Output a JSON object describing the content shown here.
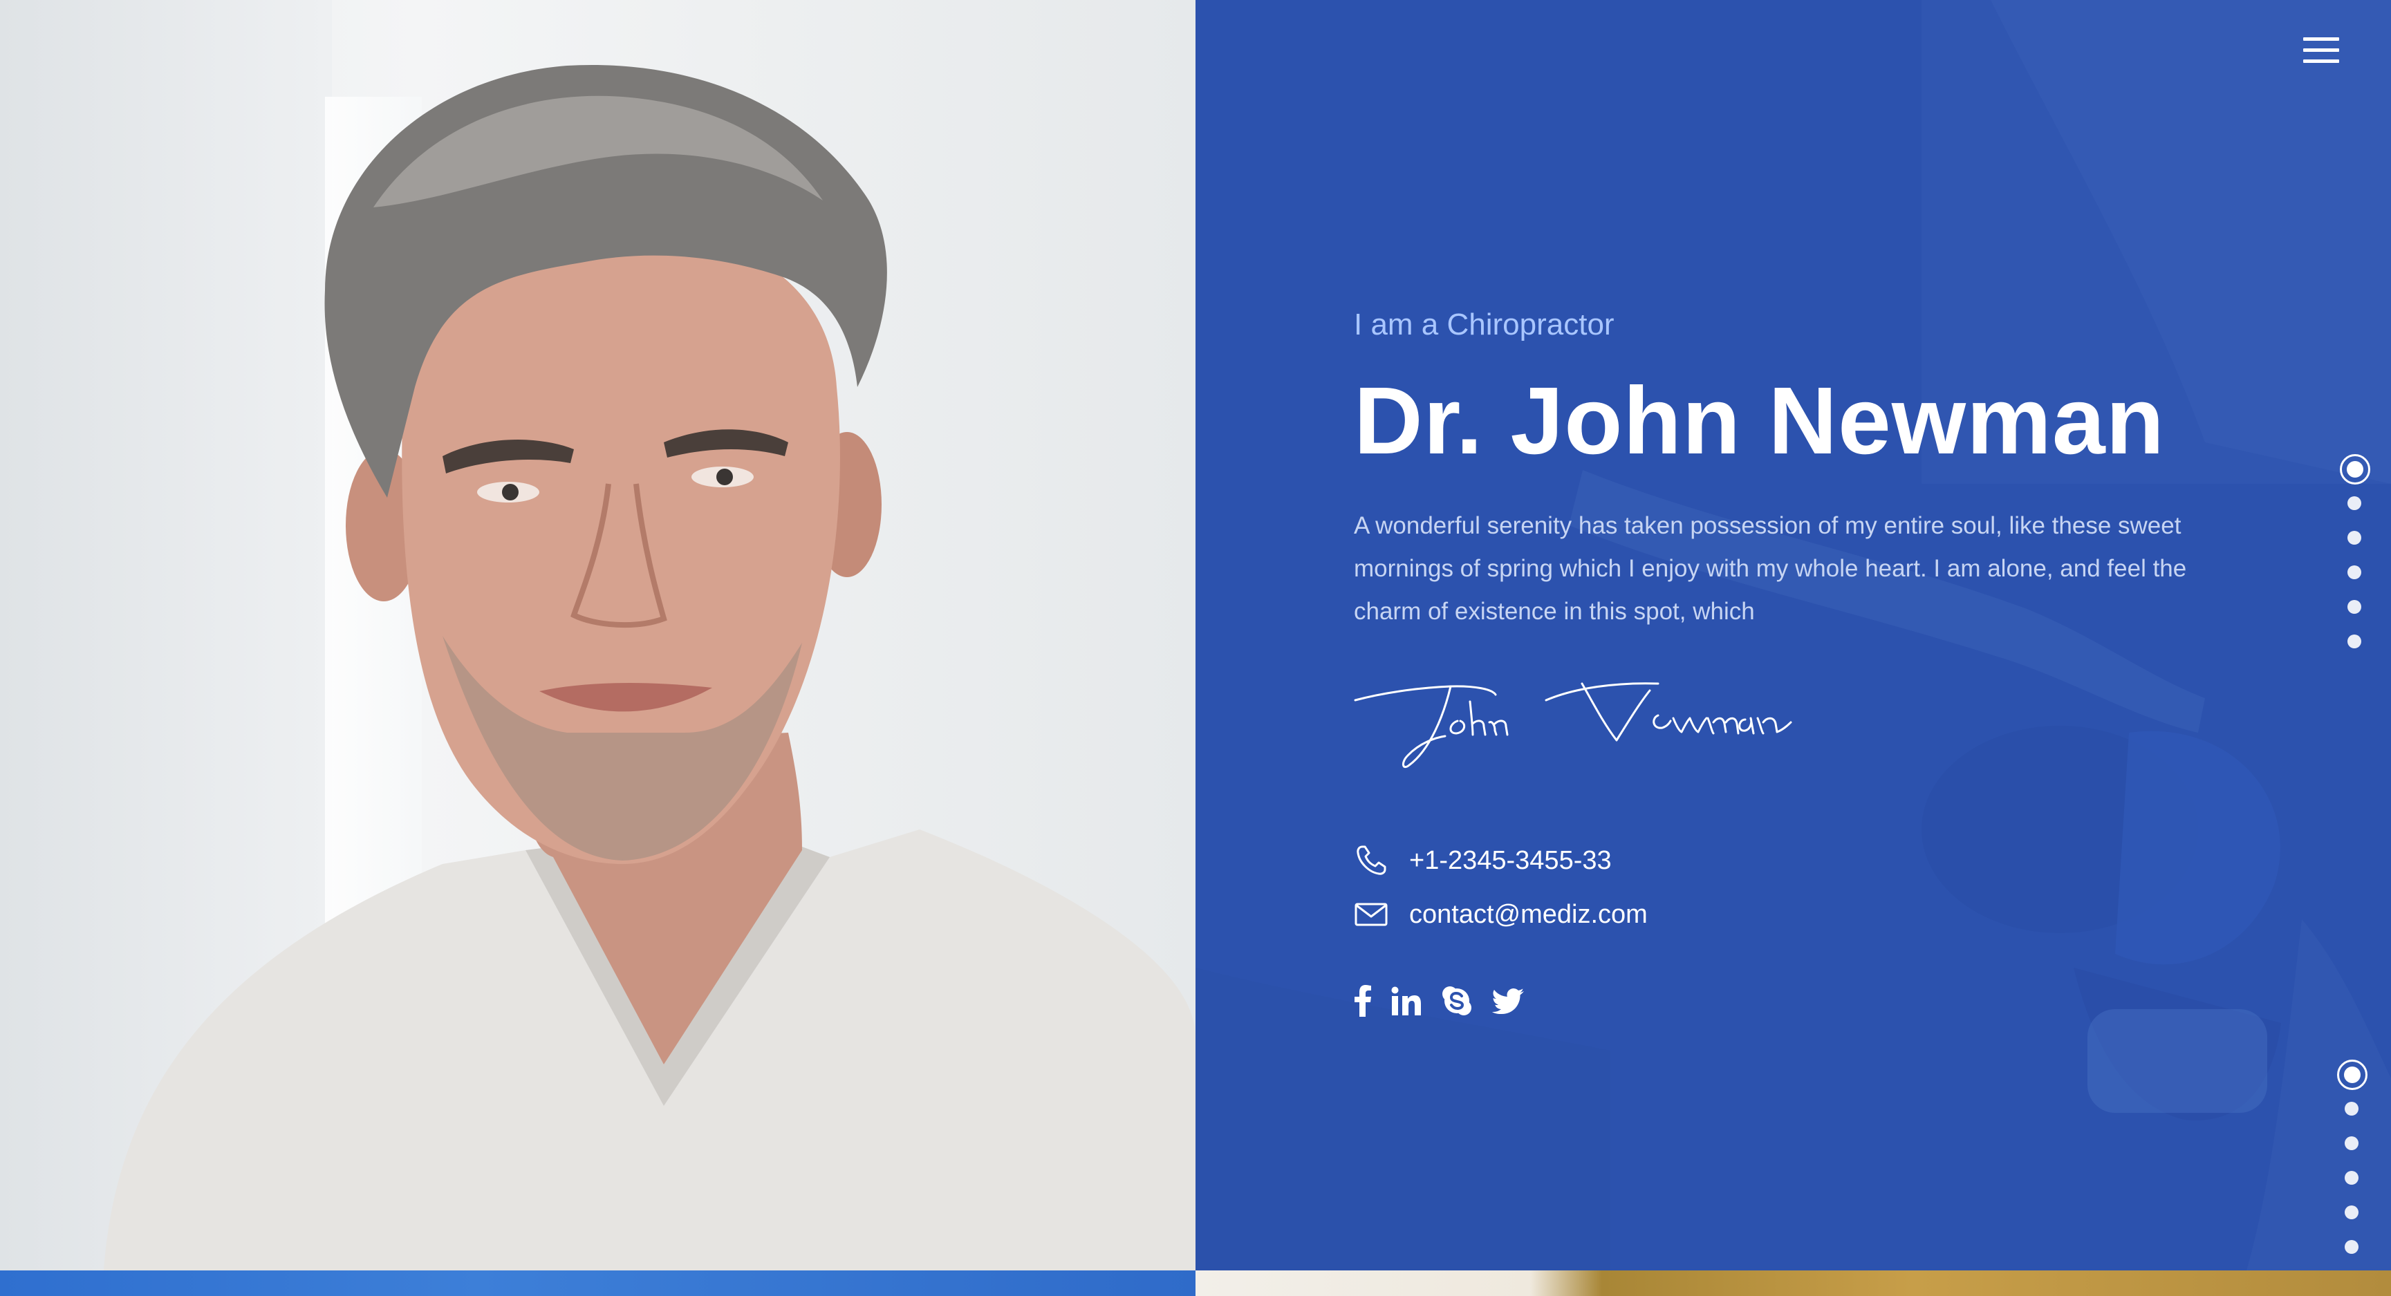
{
  "hero": {
    "subtitle": "I am a Chiropractor",
    "name": "Dr. John Newman",
    "bio": "A wonderful serenity has taken possession of my entire soul, like these sweet mornings of spring which I enjoy with my whole heart. I am alone, and feel the charm of existence in this spot, which",
    "signature": "John Newman"
  },
  "contact": {
    "phone": "+1-2345-3455-33",
    "email": "contact@mediz.com"
  },
  "social": [
    {
      "icon": "facebook-icon"
    },
    {
      "icon": "linkedin-icon"
    },
    {
      "icon": "skype-icon"
    },
    {
      "icon": "twitter-icon"
    }
  ],
  "nav": {
    "menu_icon": "hamburger-menu-icon",
    "section_dots_upper": {
      "count": 6,
      "active": 0
    },
    "section_dots_lower": {
      "count": 6,
      "active": 0
    }
  },
  "colors": {
    "hero_background": "#2c52ae",
    "subtitle": "#a9c6ff",
    "text": "#ffffff"
  }
}
